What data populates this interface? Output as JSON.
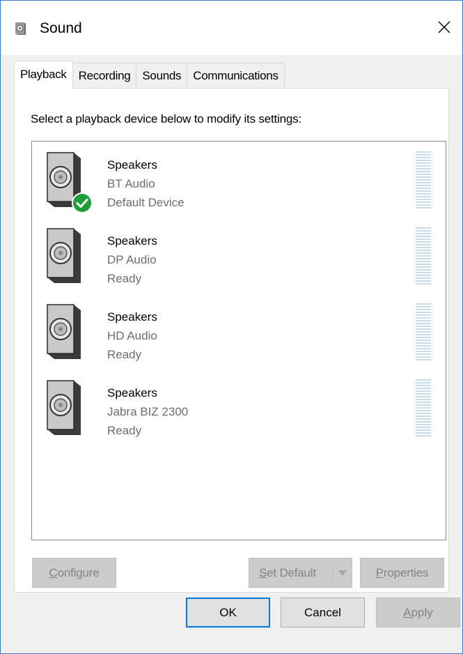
{
  "window": {
    "title": "Sound"
  },
  "tabs": [
    {
      "label": "Playback",
      "active": true
    },
    {
      "label": "Recording",
      "active": false
    },
    {
      "label": "Sounds",
      "active": false
    },
    {
      "label": "Communications",
      "active": false
    }
  ],
  "playback": {
    "instruction": "Select a playback device below to modify its settings:",
    "devices": [
      {
        "name": "Speakers",
        "description": "BT Audio",
        "status": "Default Device",
        "is_default": true
      },
      {
        "name": "Speakers",
        "description": "DP Audio",
        "status": "Ready",
        "is_default": false
      },
      {
        "name": "Speakers",
        "description": "HD Audio",
        "status": "Ready",
        "is_default": false
      },
      {
        "name": "Speakers",
        "description": "Jabra BIZ 2300",
        "status": "Ready",
        "is_default": false
      }
    ],
    "buttons": {
      "configure_u": "C",
      "configure_rest": "onfigure",
      "set_default_u": "S",
      "set_default_rest": "et Default",
      "properties_u": "P",
      "properties_rest": "roperties"
    }
  },
  "dialog_buttons": {
    "ok": "OK",
    "cancel": "Cancel",
    "apply_u": "A",
    "apply_rest": "pply"
  },
  "colors": {
    "accent": "#0078d7",
    "default_check": "#1e9e3a",
    "meter": "#c4dde9"
  },
  "icons": {
    "title": "speaker-icon",
    "close": "close-icon",
    "device": "speaker-icon",
    "default_badge": "checkmark-icon",
    "split_arrow": "chevron-down-icon"
  }
}
